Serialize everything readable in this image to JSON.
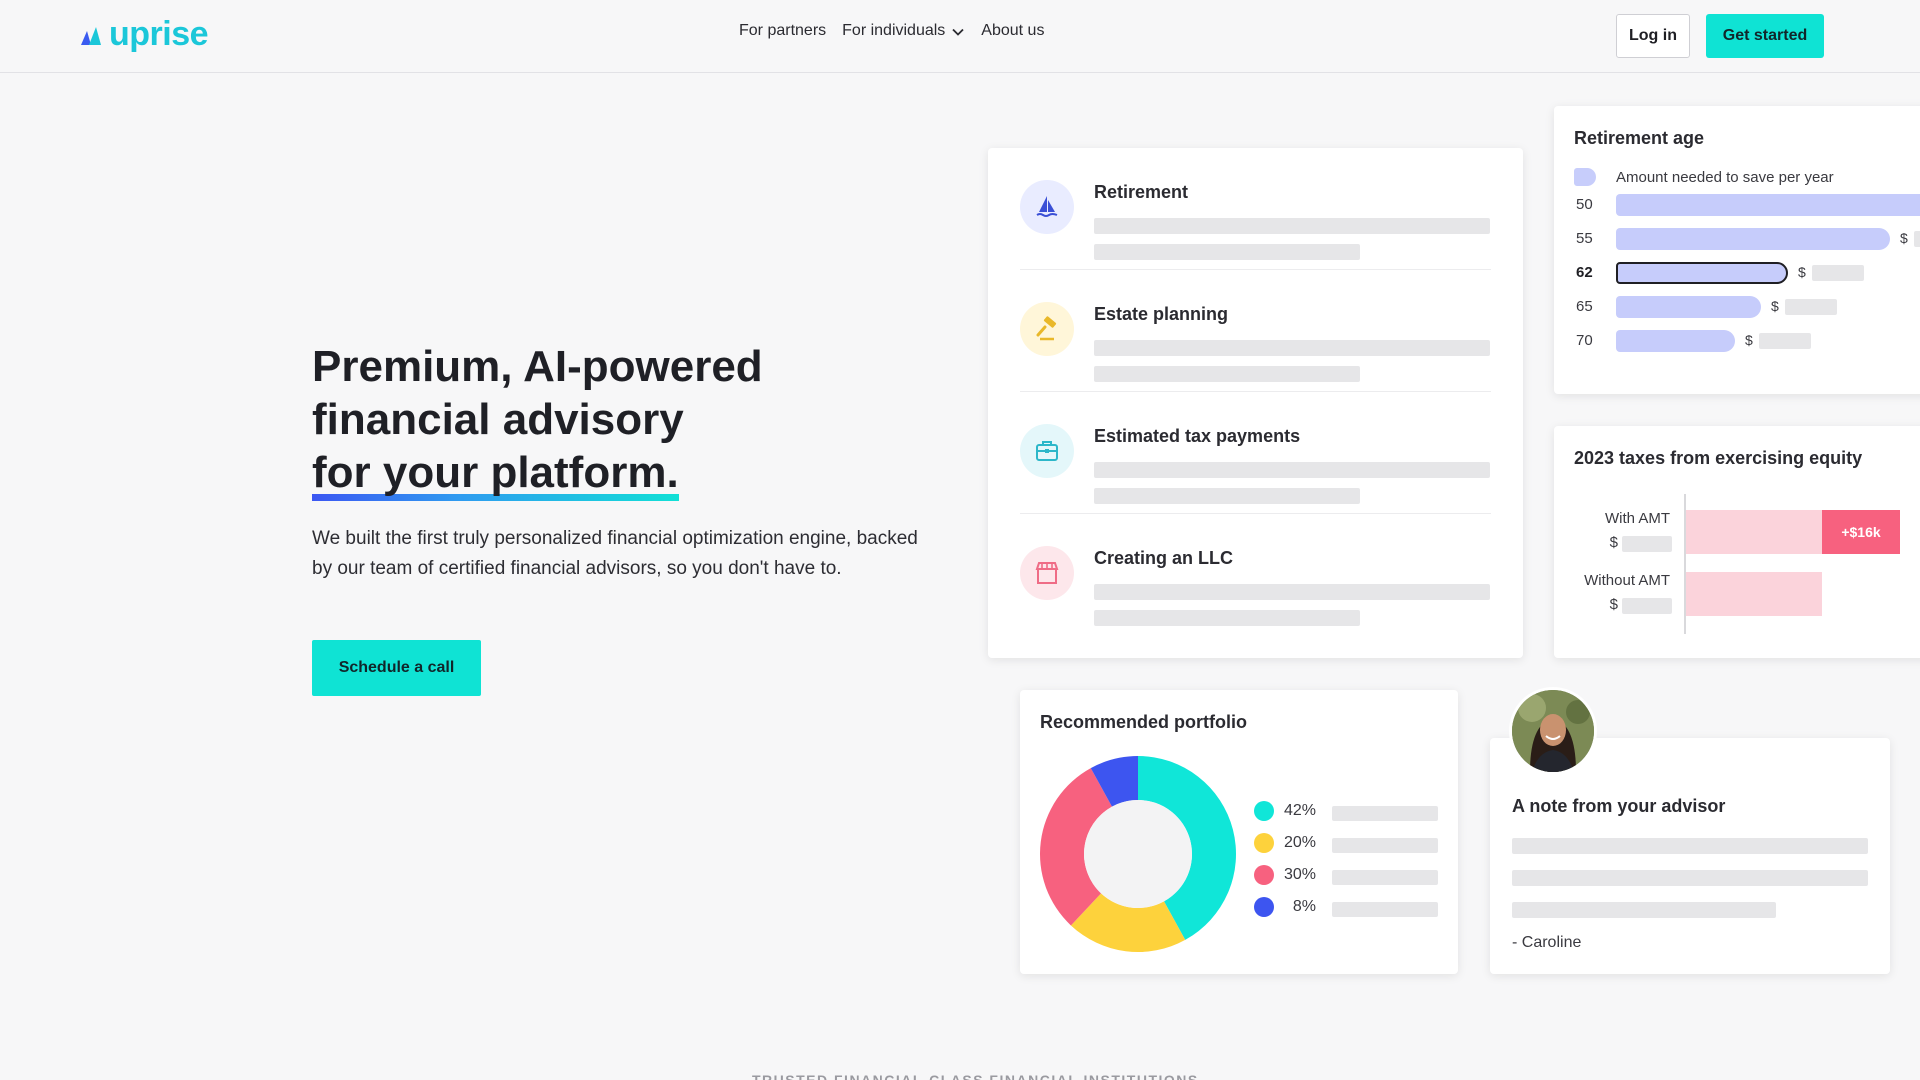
{
  "brand": {
    "logo_text": "uprise",
    "accent": "#0fe3d4",
    "logo_color": "#1bc7d9"
  },
  "nav": {
    "items": [
      {
        "label": "For partners"
      },
      {
        "label": "For individuals",
        "icon": "chevron-down-icon"
      },
      {
        "label": "About us"
      }
    ],
    "login_label": "Log in",
    "cta_label": "Get started"
  },
  "hero": {
    "title_line1": "Premium, AI-powered",
    "title_line2": "financial advisory",
    "title_line3": "for your platform.",
    "subtitle": "We built the first truly personalized financial optimization engine, backed by our team of certified financial advisors, so you don't have to.",
    "cta_label": "Schedule a call"
  },
  "goals": [
    {
      "label": "Retirement",
      "icon": "sailboat-icon",
      "icon_bg": "#e9ecff",
      "icon_color": "#3a4fd6"
    },
    {
      "label": "Estate planning",
      "icon": "gavel-icon",
      "icon_bg": "#fff6d9",
      "icon_color": "#e9b82a"
    },
    {
      "label": "Estimated tax payments",
      "icon": "briefcase-icon",
      "icon_bg": "#e4f7fa",
      "icon_color": "#2cb7c9"
    },
    {
      "label": "Creating an LLC",
      "icon": "storefront-icon",
      "icon_bg": "#fde7eb",
      "icon_color": "#ef6c86"
    }
  ],
  "retirement_age": {
    "title": "Retirement age",
    "legend": "Amount needed to save per year",
    "rows": [
      {
        "age": "50",
        "value": 1.0,
        "dollar": ""
      },
      {
        "age": "55",
        "value": 0.83,
        "dollar": "$"
      },
      {
        "age": "62",
        "value": 0.52,
        "dollar": "$",
        "selected": true
      },
      {
        "age": "65",
        "value": 0.44,
        "dollar": "$"
      },
      {
        "age": "70",
        "value": 0.36,
        "dollar": "$"
      }
    ]
  },
  "taxes": {
    "title": "2023 taxes from exercising equity",
    "with_label": "With AMT",
    "without_label": "Without AMT",
    "dollar": "$",
    "badge": "+$16k"
  },
  "portfolio": {
    "title": "Recommended portfolio",
    "slices": [
      {
        "pct": "42%",
        "value": 42,
        "color": "#10e6d8"
      },
      {
        "pct": "20%",
        "value": 20,
        "color": "#fdd23c"
      },
      {
        "pct": "30%",
        "value": 30,
        "color": "#f7617f"
      },
      {
        "pct": "8%",
        "value": 8,
        "color": "#3d55f0"
      }
    ]
  },
  "advisor_note": {
    "title": "A note from your advisor",
    "signature": "- Caroline"
  },
  "footer_hint": "TRUSTED FINANCIAL-CLASS FINANCIAL INSTITUTIONS"
}
